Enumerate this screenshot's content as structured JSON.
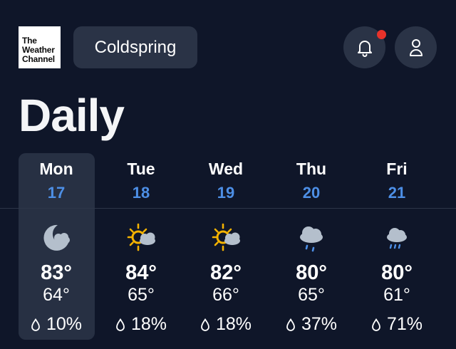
{
  "header": {
    "logo_lines": [
      "The",
      "Weather",
      "Channel"
    ],
    "location": "Coldspring",
    "has_notification": true
  },
  "page_title": "Daily",
  "colors": {
    "background": "#0f1629",
    "button": "#2a3346",
    "date_accent": "#4d8fe6",
    "notification_dot": "#e8322a",
    "sun": "#f5b301"
  },
  "days": [
    {
      "name": "Mon",
      "date": "17",
      "icon": "moon-cloud-icon",
      "high": "83°",
      "low": "64°",
      "precip": "10%",
      "selected": true
    },
    {
      "name": "Tue",
      "date": "18",
      "icon": "sun-cloud-icon",
      "high": "84°",
      "low": "65°",
      "precip": "18%",
      "selected": false
    },
    {
      "name": "Wed",
      "date": "19",
      "icon": "sun-cloud-icon",
      "high": "82°",
      "low": "66°",
      "precip": "18%",
      "selected": false
    },
    {
      "name": "Thu",
      "date": "20",
      "icon": "rain-cloud-icon",
      "high": "80°",
      "low": "65°",
      "precip": "37%",
      "selected": false
    },
    {
      "name": "Fri",
      "date": "21",
      "icon": "rain-cloud-icon",
      "high": "80°",
      "low": "61°",
      "precip": "71%",
      "selected": false
    }
  ]
}
